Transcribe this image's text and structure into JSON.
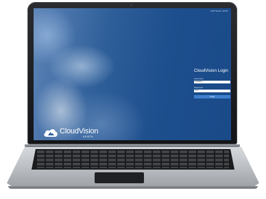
{
  "screen": {
    "top_status": "CVP Server: 10.81.",
    "login": {
      "title": "CloudVision Login",
      "username_label": "Username",
      "username_value": "cvpadmin",
      "password_label": "Password",
      "password_value": "••••••",
      "login_button": "Login"
    },
    "brand": {
      "logo_icon": "cloud-icon",
      "name": "CloudVision",
      "sub": "ARISTA"
    }
  },
  "colors": {
    "screen_blue": "#1d4e8d",
    "login_button": "#3f7fcf",
    "bezel": "#141518",
    "chassis": "#c5c8cc"
  }
}
